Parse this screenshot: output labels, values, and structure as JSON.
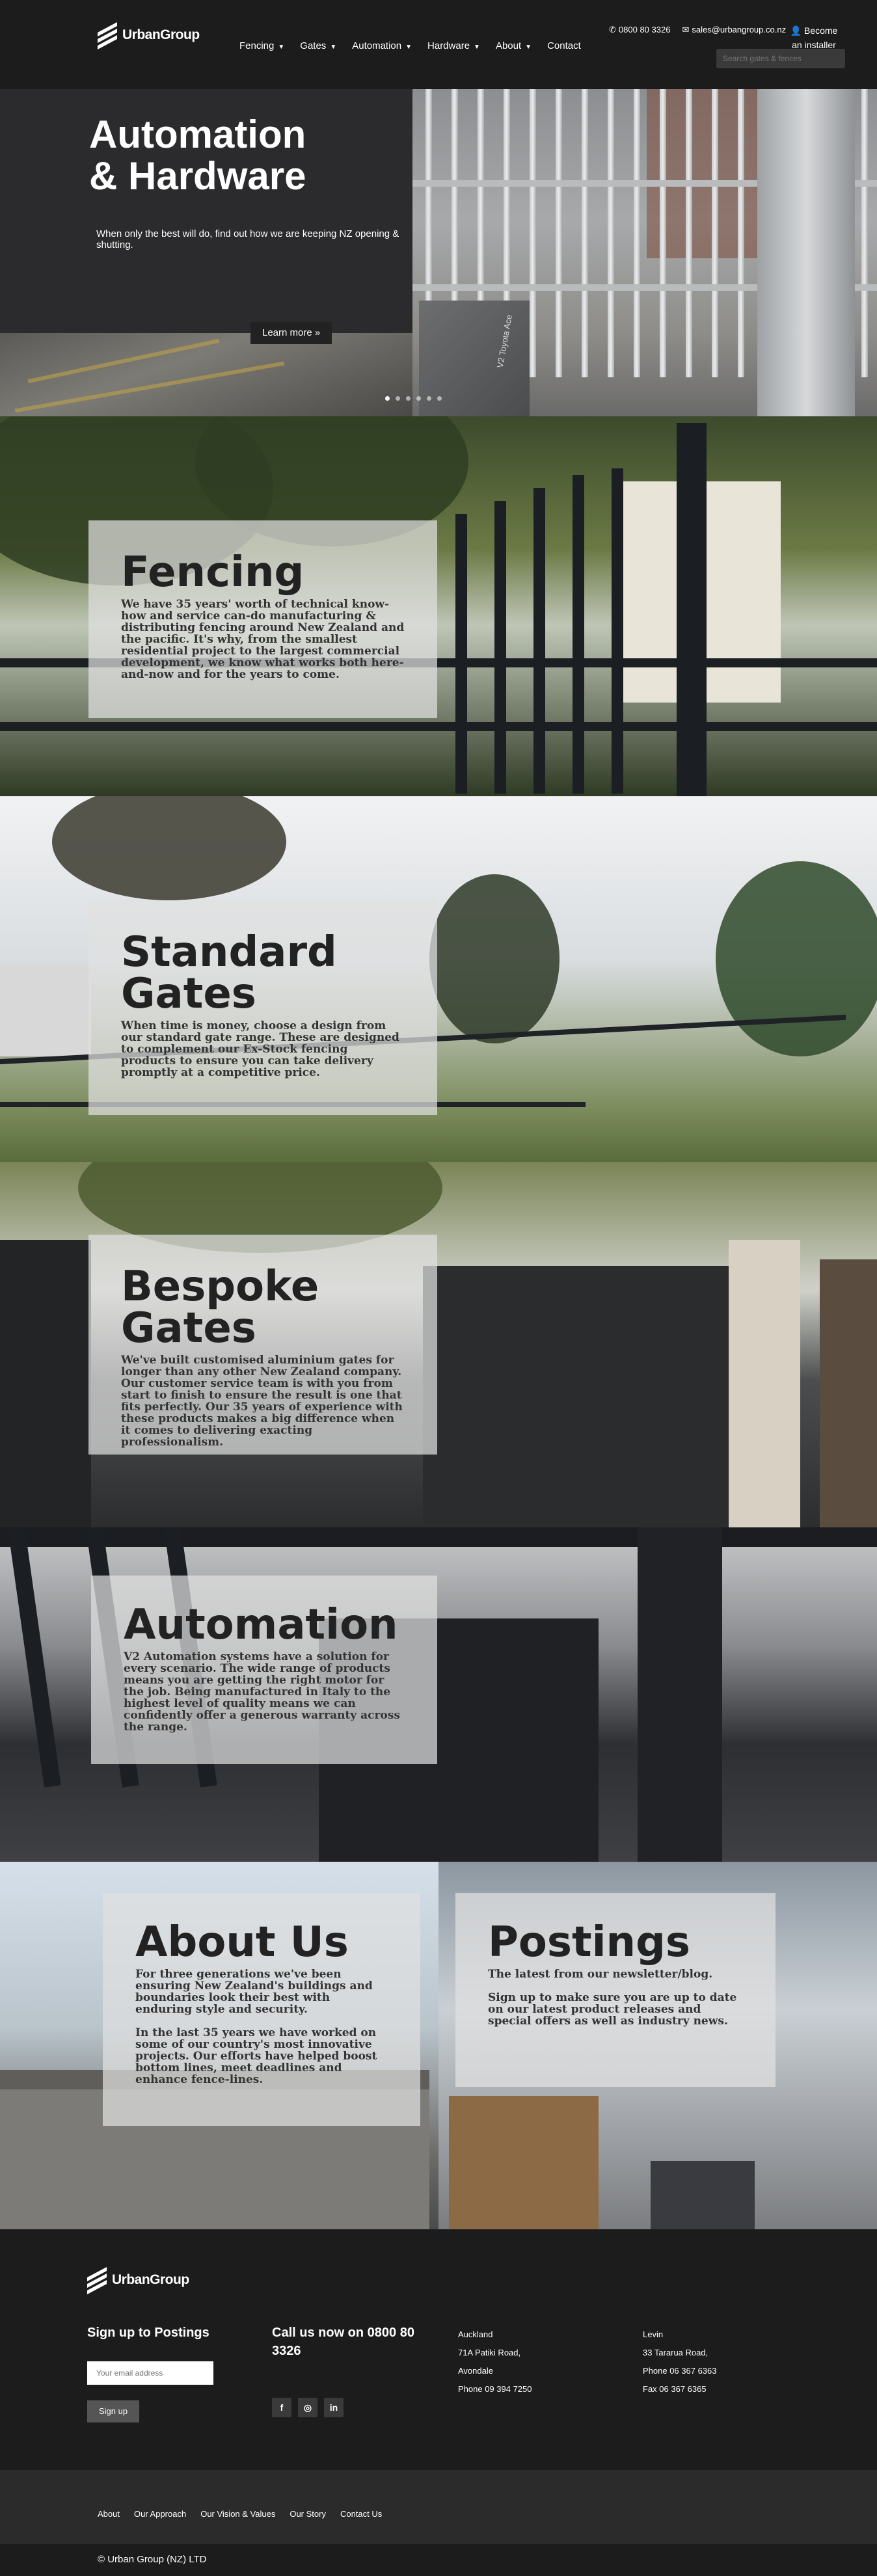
{
  "header": {
    "logo_text": "UrbanGroup",
    "nav": [
      {
        "label": "Fencing",
        "has_dropdown": true
      },
      {
        "label": "Gates",
        "has_dropdown": true
      },
      {
        "label": "Automation",
        "has_dropdown": true
      },
      {
        "label": "Hardware",
        "has_dropdown": true
      },
      {
        "label": "About",
        "has_dropdown": true
      },
      {
        "label": "Contact",
        "has_dropdown": false
      }
    ],
    "phone": "0800 80 3326",
    "email": "sales@urbangroup.co.nz",
    "installer_link": "Become an installer",
    "search_placeholder": "Search gates & fences"
  },
  "hero": {
    "title_line1": "Automation",
    "title_line2": "& Hardware",
    "subtitle": "When only the best will do, find out how we are keeping NZ opening & shutting.",
    "button_label": "Learn more",
    "button_icon": "chevron-right-double",
    "motor_label": "V2 Toyota Ace",
    "slide_count": 6,
    "active_slide": 0
  },
  "sections": {
    "fencing": {
      "title": "Fencing",
      "body": "We have 35 years' worth of technical know-how and service can-do manufacturing & distributing fencing around New Zealand and the pacific. It's why, from the smallest residential project to the largest commercial development, we know what works both here-and-now and for the years to come."
    },
    "standard_gates": {
      "title_line1": "Standard",
      "title_line2": "Gates",
      "body": "When time is money, choose a design from our standard gate range. These are designed to complement our Ex-Stock fencing products to ensure you can take delivery promptly at a competitive price."
    },
    "bespoke_gates": {
      "title_line1": "Bespoke",
      "title_line2": "Gates",
      "body": "We've built customised aluminium gates for longer than any other New Zealand company. Our customer service team is with you from start to finish to ensure the result is one that fits perfectly.  Our 35 years of experience with these products makes a big difference when it comes to delivering exacting professionalism."
    },
    "automation": {
      "title": "Automation",
      "body": "V2 Automation systems have a solution for every scenario. The wide range of products means you are getting the right motor for the job. Being manufactured in Italy to the highest level of quality means we can confidently offer a generous warranty across the range."
    },
    "about": {
      "title": "About Us",
      "body1": "For three generations we've been ensuring New Zealand's buildings and boundaries look their best with enduring style and security.",
      "body2": "In the last 35 years we have worked on some of our country's most innovative projects. Our efforts have helped boost bottom lines, meet deadlines and enhance fence-lines."
    },
    "postings": {
      "title": "Postings",
      "body1": "The latest from our newsletter/blog.",
      "body2": "Sign up to make sure you are up to date on our latest product releases and special offers as well as industry news."
    }
  },
  "footer": {
    "logo_text": "UrbanGroup",
    "signup_heading": "Sign up to Postings",
    "email_placeholder": "Your email address",
    "signup_button": "Sign up",
    "call_heading": "Call us now on 0800 80 3326",
    "socials": [
      {
        "name": "facebook-icon",
        "glyph": "f"
      },
      {
        "name": "instagram-icon",
        "glyph": "◎"
      },
      {
        "name": "linkedin-icon",
        "glyph": "in"
      }
    ],
    "auckland": {
      "city": "Auckland",
      "line1": "71A Patiki Road,",
      "line2": "Avondale",
      "phone": "Phone 09 394 7250"
    },
    "levin": {
      "city": "Levin",
      "line1": "33 Tararua Road,",
      "phone": "Phone 06 367 6363",
      "fax": "Fax 06 367 6365"
    },
    "bottom_links": [
      "About",
      "Our Approach",
      "Our Vision & Values",
      "Our Story",
      "Contact Us"
    ],
    "copyright": "© Urban Group (NZ) LTD"
  }
}
